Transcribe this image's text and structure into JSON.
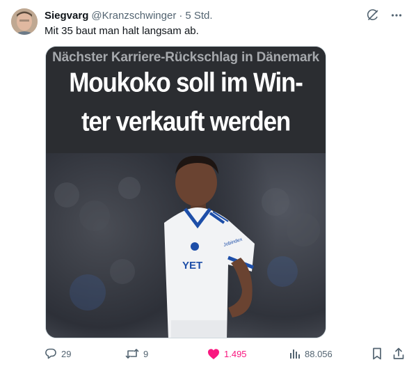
{
  "tweet": {
    "author_name": "Siegvarg",
    "author_handle": "@Kranzschwinger",
    "separator": "·",
    "time": "5 Std.",
    "text": "Mit 35 baut man halt langsam ab."
  },
  "media": {
    "kicker": "Nächster Karriere-Rückschlag in Dänemark",
    "headline_line1": "Moukoko soll im Win-",
    "headline_line2": "ter verkauft werden",
    "sponsor_text": "YET",
    "chest_text": "Jobindex"
  },
  "actions": {
    "replies": "29",
    "reposts": "9",
    "likes": "1.495",
    "views": "88.056"
  },
  "icons": {
    "grok": "grok-icon",
    "more": "more-icon",
    "reply": "reply-icon",
    "repost": "repost-icon",
    "like": "heart-icon",
    "views": "views-icon",
    "bookmark": "bookmark-icon",
    "share": "share-icon"
  },
  "colors": {
    "text": "#0f1419",
    "secondary": "#536471",
    "like_pink": "#f91880",
    "headline_bg": "#2b2d31"
  }
}
